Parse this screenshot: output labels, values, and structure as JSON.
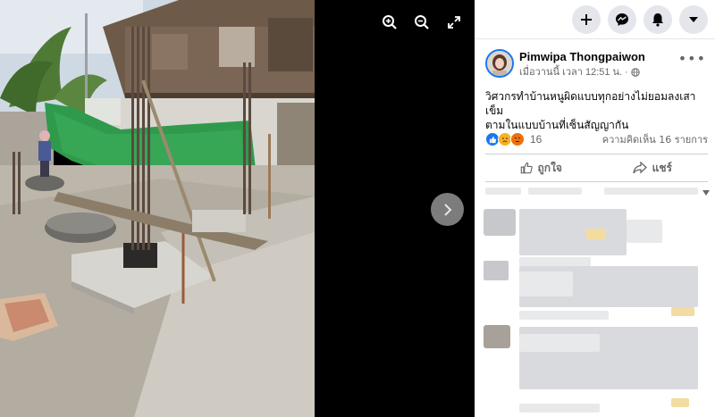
{
  "viewer": {
    "tools": [
      {
        "name": "zoom-in-icon"
      },
      {
        "name": "zoom-out-icon"
      },
      {
        "name": "fullscreen-icon"
      }
    ],
    "next_icon": "chevron-right-icon"
  },
  "topbar": {
    "buttons": [
      "plus-icon",
      "messenger-icon",
      "bell-icon",
      "caret-down-icon"
    ]
  },
  "post": {
    "author": "Pimwipa Thongpaiwon",
    "time": "เมื่อวานนี้ เวลา 12:51 น.",
    "audience_icon": "globe-icon",
    "text_line1": "วิศวกรทำบ้านหนูผิดแบบทุกอย่างไม่ยอมลงเสาเข็ม",
    "text_line2": "ตามในแบบบ้านที่เซ็นสัญญากัน",
    "reactions": [
      "like-icon",
      "sad-icon",
      "angry-icon"
    ],
    "reaction_count": "16",
    "comment_count": "ความคิดเห็น 16 รายการ",
    "like_label": "ถูกใจ",
    "share_label": "แชร์"
  },
  "colors": {
    "accent": "#1877f2",
    "secondary_text": "#65676b",
    "divider": "#ced0d4",
    "button_bg": "#e4e6eb"
  }
}
